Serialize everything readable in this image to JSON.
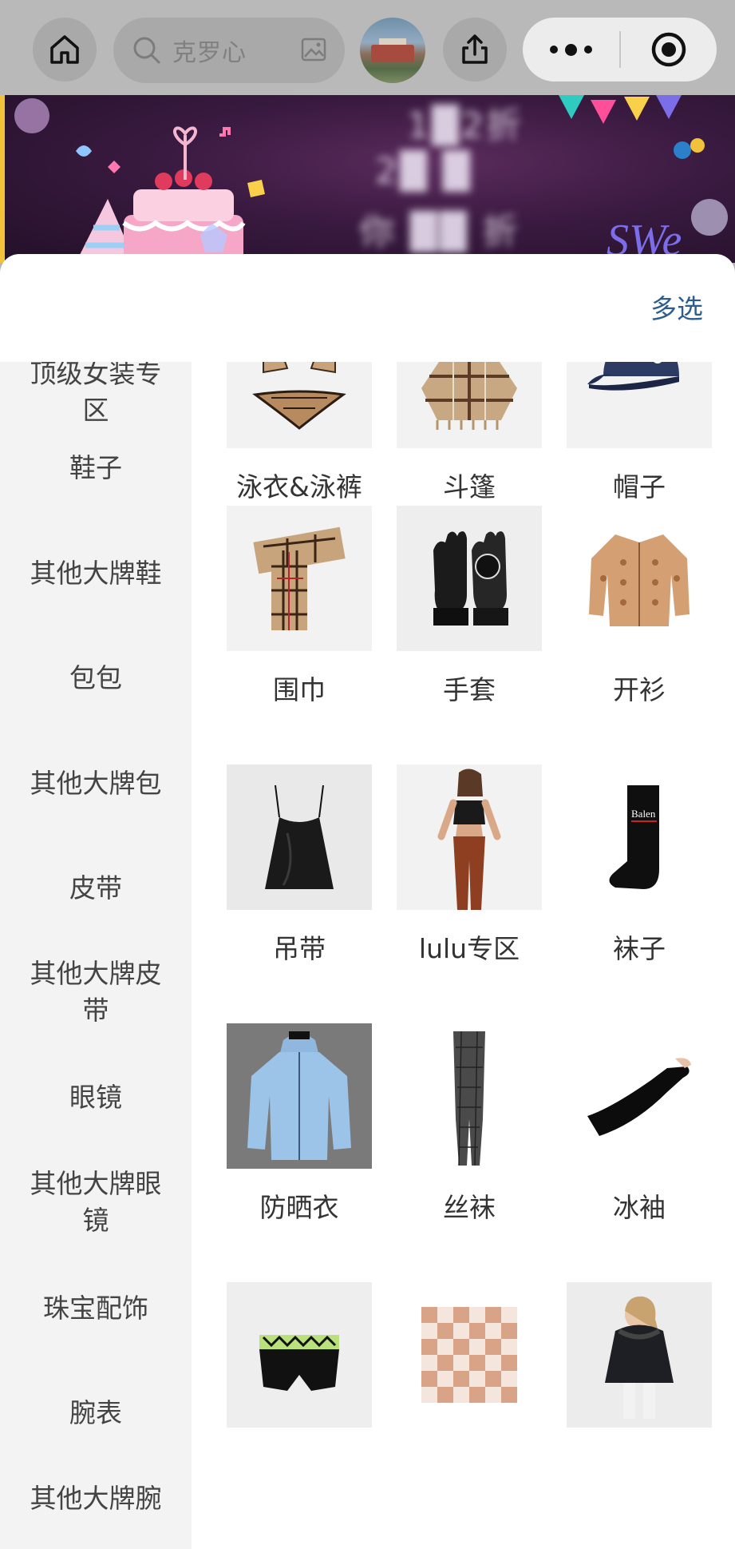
{
  "header": {
    "search_text": "克罗心",
    "icons": [
      "home-icon",
      "search-icon",
      "image-search-icon",
      "avatar",
      "share-icon",
      "more-dots-icon",
      "record-target-icon"
    ]
  },
  "banner": {
    "line1": "1█2折",
    "line2": "2█ █",
    "line3": "你 ██ 折",
    "corner_text": "SWe"
  },
  "panel": {
    "multi_select": "多选"
  },
  "sidebar": {
    "items": [
      {
        "label": "顶级女装专区"
      },
      {
        "label": "鞋子"
      },
      {
        "label": "其他大牌鞋"
      },
      {
        "label": "包包"
      },
      {
        "label": "其他大牌包"
      },
      {
        "label": "皮带"
      },
      {
        "label": "其他大牌皮带"
      },
      {
        "label": "眼镜"
      },
      {
        "label": "其他大牌眼镜"
      },
      {
        "label": "珠宝配饰"
      },
      {
        "label": "腕表"
      },
      {
        "label": "其他大牌腕"
      }
    ]
  },
  "products": [
    {
      "label": "泳衣&泳裤",
      "icon": "bikini-image"
    },
    {
      "label": "斗篷",
      "icon": "cape-image"
    },
    {
      "label": "帽子",
      "icon": "cap-image"
    },
    {
      "label": "围巾",
      "icon": "scarf-image"
    },
    {
      "label": "手套",
      "icon": "gloves-image"
    },
    {
      "label": "开衫",
      "icon": "cardigan-image"
    },
    {
      "label": "吊带",
      "icon": "camisole-image"
    },
    {
      "label": "lulu专区",
      "icon": "lulu-image"
    },
    {
      "label": "袜子",
      "icon": "socks-image"
    },
    {
      "label": "防晒衣",
      "icon": "sun-jacket-image"
    },
    {
      "label": "丝袜",
      "icon": "stockings-image"
    },
    {
      "label": "冰袖",
      "icon": "arm-sleeve-image"
    },
    {
      "label": "",
      "icon": "underwear-image"
    },
    {
      "label": "",
      "icon": "blanket-image"
    },
    {
      "label": "",
      "icon": "kids-jacket-image"
    }
  ],
  "colors": {
    "accent": "#2d5d8c",
    "topbar": "#b9b9b9",
    "sidebar_bg": "#f3f3f3"
  }
}
